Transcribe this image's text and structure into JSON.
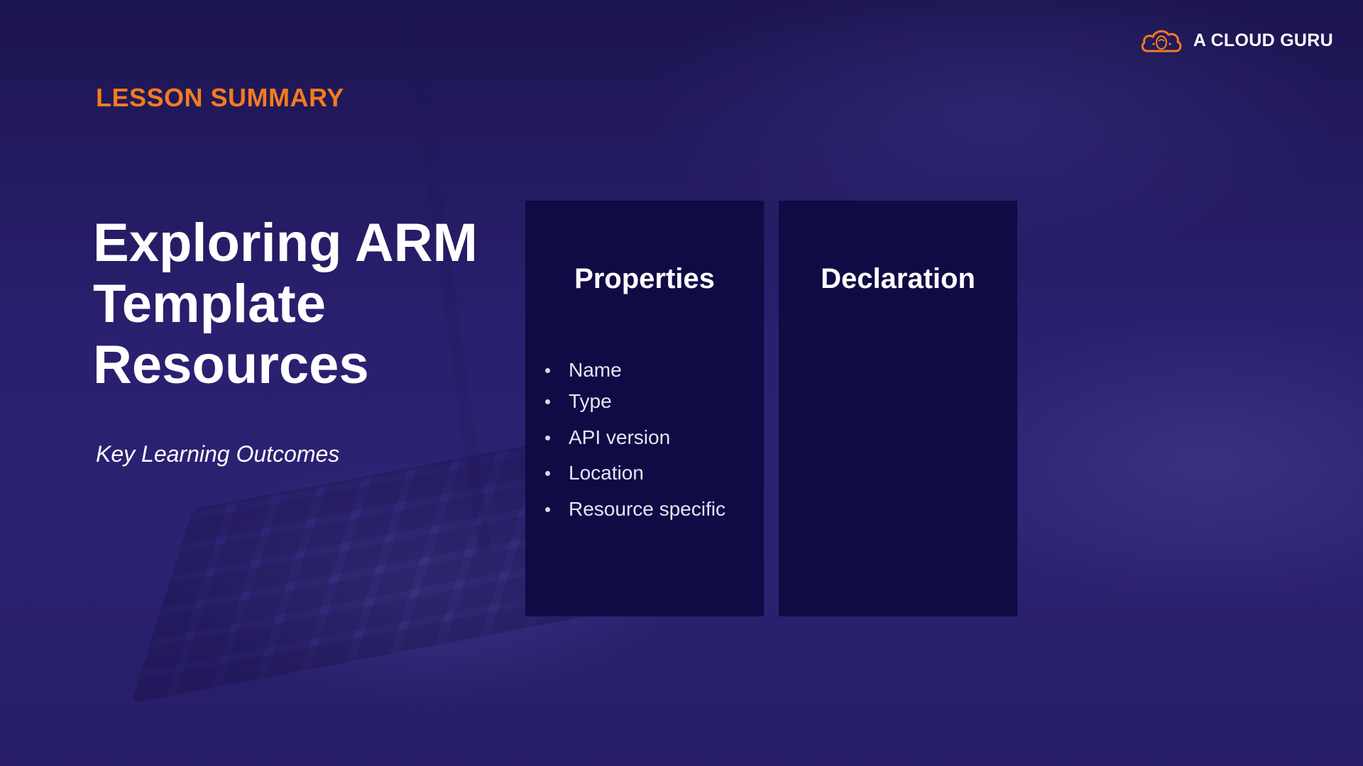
{
  "brand": {
    "name": "A CLOUD GURU",
    "logo_icon": "cloud-logo-icon",
    "logo_color": "#f37b20"
  },
  "eyebrow": "LESSON SUMMARY",
  "title_lines": [
    "Exploring ARM",
    "Template",
    "Resources"
  ],
  "subtitle": "Key Learning Outcomes",
  "panels": [
    {
      "heading": "Properties",
      "items": [
        "Name",
        "Type",
        "API version",
        "Location",
        "Resource specific"
      ]
    },
    {
      "heading": "Declaration",
      "items": []
    }
  ],
  "colors": {
    "accent": "#f37b20",
    "panel_bg": "#100a45",
    "background": "#241a5e"
  }
}
